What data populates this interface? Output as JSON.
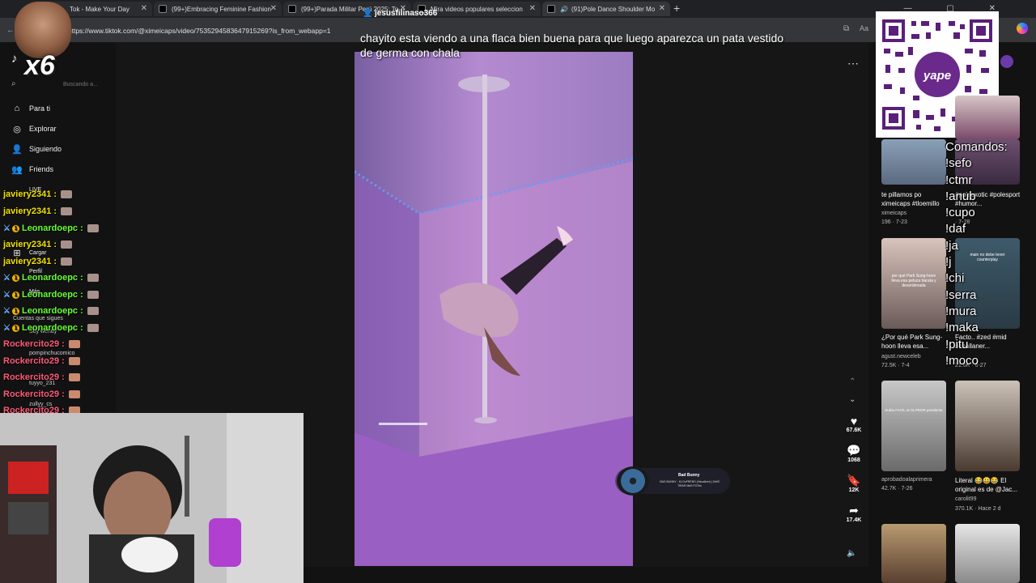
{
  "browser": {
    "tabs": [
      {
        "title": "Tok - Make Your Day"
      },
      {
        "title": "(99+)Embracing Feminine Fashion"
      },
      {
        "title": "(99+)Parada Militar Perú 2025: To"
      },
      {
        "title": "Mira videos populares seleccion"
      },
      {
        "title": "(91)Pole Dance Shoulder Mo"
      }
    ],
    "new_tab": "+",
    "url": "https://www.tiktok.com/@ximeicaps/video/7535294583647915269?is_from_webapp=1",
    "window_controls": "— ▢ ✕"
  },
  "stream": {
    "streamer": "jesusfilinaso366",
    "multiplier": "x6",
    "overlay_text": "chayito esta viendo a una flaca bien buena para que luego aparezca un pata vestido de germa con chala"
  },
  "sidebar": {
    "search_hint": "Buscando a...",
    "items": [
      {
        "label": "Para ti",
        "icon": "home-icon"
      },
      {
        "label": "Explorar",
        "icon": "compass-icon"
      },
      {
        "label": "Siguiendo",
        "icon": "following-icon"
      },
      {
        "label": "Friends",
        "icon": "friends-icon"
      },
      {
        "label": "LIVE",
        "icon": "live-icon"
      },
      {
        "label": "Cargar",
        "icon": "upload-icon"
      },
      {
        "label": "Perfil",
        "icon": "profile-icon"
      },
      {
        "label": "Más",
        "icon": "more-icon"
      }
    ],
    "following_header": "Cuentas que sigues",
    "following": [
      "Soy wendy",
      "pompinchucomico",
      "tuyyo_231",
      "zullyy_cs"
    ]
  },
  "chat": [
    {
      "user": "javiery2341",
      "color": "#f2e100",
      "badges": false
    },
    {
      "user": "javiery2341",
      "color": "#f2e100",
      "badges": false
    },
    {
      "user": "Leonardoepc",
      "color": "#66ff33",
      "badges": true
    },
    {
      "user": "javiery2341",
      "color": "#f2e100",
      "badges": false
    },
    {
      "user": "javiery2341",
      "color": "#f2e100",
      "badges": false
    },
    {
      "user": "Leonardoepc",
      "color": "#66ff33",
      "badges": true
    },
    {
      "user": "Leonardoepc",
      "color": "#66ff33",
      "badges": true
    },
    {
      "user": "Leonardoepc",
      "color": "#66ff33",
      "badges": true
    },
    {
      "user": "Leonardoepc",
      "color": "#66ff33",
      "badges": true
    },
    {
      "user": "Rockercito29",
      "color": "#ff5a7a",
      "badges": false
    },
    {
      "user": "Rockercito29",
      "color": "#ff5a7a",
      "badges": false
    },
    {
      "user": "Rockercito29",
      "color": "#ff5a7a",
      "badges": false
    },
    {
      "user": "Rockercito29",
      "color": "#ff5a7a",
      "badges": false
    },
    {
      "user": "Rockercito29",
      "color": "#ff5a7a",
      "badges": false
    }
  ],
  "chat_separator": ":",
  "actions": {
    "likes": "67.6K",
    "comments": "1068",
    "saves": "12K",
    "shares": "17.4K"
  },
  "music": {
    "title": "Bad Bunny",
    "subtitle": "BAD BUNNY - KLOuFRENS (Visualizer) | DeBÍ TiRAR MáS FOTos"
  },
  "qr": {
    "brand": "yape"
  },
  "commands_overlay": [
    "Comandos:",
    "!sefo",
    "!ctmr",
    "!anub",
    "!cupo",
    "!daf",
    "!ja",
    "!j",
    "!chi",
    "!serra",
    "!mura",
    "!maka",
    "!pitu",
    "!moco"
  ],
  "recommended": [
    {
      "caption": "te pillamos po ximeicaps #tloemillo",
      "author": "ximeicaps",
      "stats": "196 · 7-23"
    },
    {
      "caption": "#poleexotic #polesport #humor...",
      "author": "",
      "stats": "· 7-28"
    },
    {
      "caption": "¿Por qué Park Sung-hoon lleva esa...",
      "author": "agust.newceleb",
      "stats": "72.5K · 7-4"
    },
    {
      "caption": "Facto.. #zed #mid #challaner...",
      "author": "",
      "stats": "21.6K · 6-27"
    },
    {
      "caption": "",
      "author": "aprobadoalaprimera",
      "stats": "42.7K · 7-26"
    },
    {
      "caption": "Literal 😂😀😂 El original es de @Jac...",
      "author": "carolit99",
      "stats": "370.1K · Hace 2 d"
    }
  ],
  "thumb_texts": {
    "t3": "por qué Park Sung-hoon lleva esa peluca barata y desordenada",
    "t4": "main no debe tener counterplay",
    "t5": "Subía FACIL en la PEOR pendiente"
  }
}
